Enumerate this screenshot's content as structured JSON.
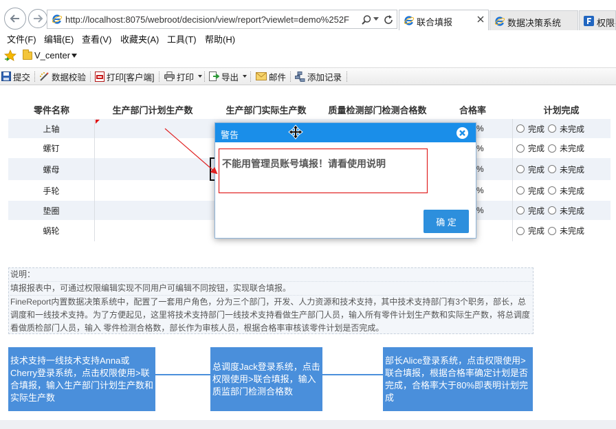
{
  "browser": {
    "url": "http://localhost:8075/webroot/decision/view/report?viewlet=demo%252F",
    "tabs": [
      {
        "label": "联合填报",
        "active": true,
        "icon": "ie-icon"
      },
      {
        "label": "数据决策系统",
        "icon": "ie-icon"
      },
      {
        "label": "权限-",
        "icon": "finereport-icon"
      }
    ]
  },
  "menu": {
    "items": [
      "文件(F)",
      "编辑(E)",
      "查看(V)",
      "收藏夹(A)",
      "工具(T)",
      "帮助(H)"
    ]
  },
  "favorites": {
    "folder": "V_center"
  },
  "toolbar": {
    "items": [
      {
        "label": "提交",
        "icon": "save-icon"
      },
      {
        "label": "数据校验",
        "icon": "validate-icon"
      },
      {
        "label": "打印[客户端]",
        "icon": "pdf-print-icon"
      },
      {
        "label": "打印",
        "icon": "printer-icon",
        "dropdown": true
      },
      {
        "label": "导出",
        "icon": "export-icon",
        "dropdown": true
      },
      {
        "label": "邮件",
        "icon": "mail-icon"
      },
      {
        "label": "添加记录",
        "icon": "add-record-icon"
      }
    ]
  },
  "table": {
    "headers": [
      "零件名称",
      "生产部门计划生产数",
      "生产部门实际生产数",
      "质量检测部门检测合格数",
      "合格率",
      "计划完成"
    ],
    "rows": [
      {
        "name": "上轴",
        "rate": "%"
      },
      {
        "name": "螺钉",
        "rate": "%"
      },
      {
        "name": "螺母",
        "rate": "%"
      },
      {
        "name": "手轮",
        "rate": "%"
      },
      {
        "name": "垫圈",
        "rate": "%"
      },
      {
        "name": "蜗轮"
      }
    ],
    "options": [
      "完成",
      "未完成"
    ]
  },
  "dialog": {
    "title": "警告",
    "message": "不能用管理员账号填报！请看使用说明",
    "ok": "确 定"
  },
  "info": {
    "heading": "说明：",
    "line1": "填报报表中，可通过权限编辑实现不同用户可编辑不同按钮，实现联合填报。",
    "line2": "FineReport内置数据决策系统中，配置了一套用户角色，分为三个部门，开发、人力资源和技术支持，其中技术支持部门有3个职务，部长，总调度和一线技术支持。为了方便起见，这里将技术支持部门一线技术支持看做生产部门人员，输入所有零件计划生产数和实际生产数，将总调度看做质检部门人员，输入 零件检测合格数，部长作为审核人员，根据合格率审核该零件计划是否完成。"
  },
  "steps": [
    "技术支持一线技术支持Anna或Cherry登录系统，点击权限使用>联合填报，输入生产部门计划生产数和实际生产数",
    "总调度Jack登录系统，点击权限使用>联合填报，输入质监部门检测合格数",
    "部长Alice登录系统，点击权限使用>联合填报，根据合格率确定计划是否完成，合格率大于80%即表明计划完成"
  ],
  "colors": {
    "dialog_header": "#1a8ee9",
    "ok_button": "#2d8fdd",
    "step_box": "#4a8fdb",
    "annotation": "#e02020",
    "row_alt": "#eef2f8"
  }
}
